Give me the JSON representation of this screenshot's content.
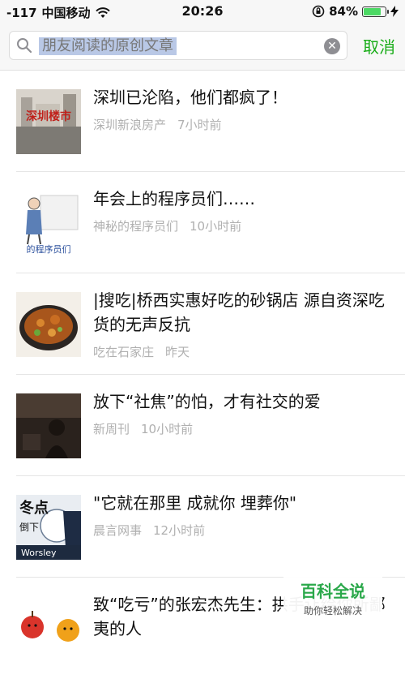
{
  "status_bar": {
    "signal": "-117",
    "carrier": "中国移动",
    "time": "20:26",
    "battery": "84%",
    "battery_level": 0.84,
    "accent_color": "#4cd964"
  },
  "search": {
    "query": "朋友阅读的原创文章",
    "cancel_label": "取消",
    "accent_color": "#1aad19"
  },
  "results": [
    {
      "title": "深圳已沦陷，他们都疯了！",
      "source": "深圳新浪房产",
      "time": "7小时前",
      "thumb": "深圳楼市",
      "two_line": false
    },
    {
      "title": "年会上的程序员们……",
      "source": "神秘的程序员们",
      "time": "10小时前",
      "thumb": "的程序员们",
      "two_line": false
    },
    {
      "title": "|搜吃|桥西实惠好吃的砂锅店 源自资深吃货的无声反抗",
      "source": "吃在石家庄",
      "time": "昨天",
      "thumb": "",
      "two_line": true
    },
    {
      "title": "放下“社焦”的怕，才有社交的爱",
      "source": "新周刊",
      "time": "10小时前",
      "thumb": "",
      "two_line": false
    },
    {
      "title": "\"它就在那里 成就你 埋葬你\"",
      "source": "晨言网事",
      "time": "12小时前",
      "thumb": "冬点 倒下 Worsley",
      "two_line": false
    },
    {
      "title": "致“吃亏”的张宏杰先生：拱手让给你所鄙夷的人",
      "source": "",
      "time": "",
      "thumb": "",
      "two_line": true
    }
  ],
  "watermark": {
    "title": "百科全说",
    "subtitle": "助你轻松解决"
  }
}
